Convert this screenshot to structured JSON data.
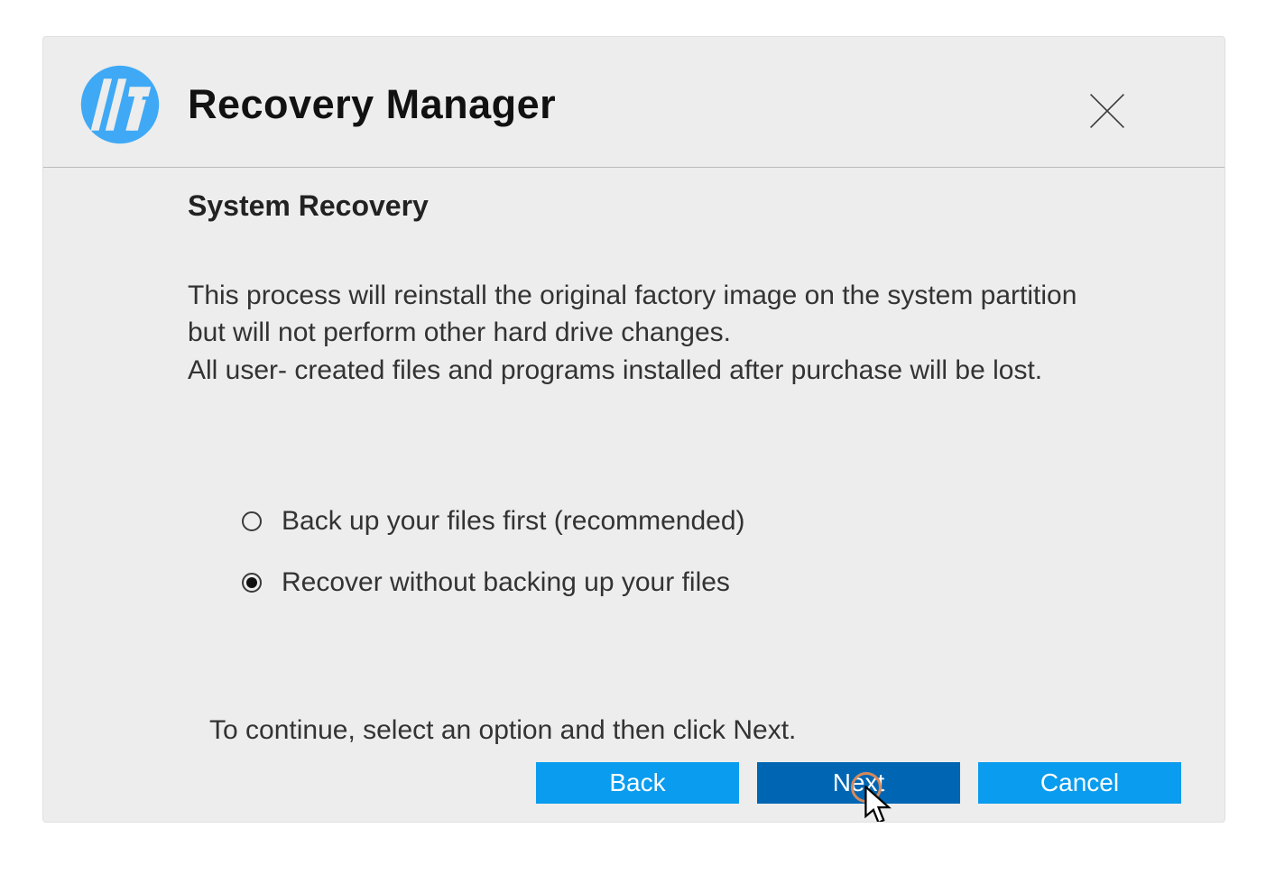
{
  "header": {
    "app_title": "Recovery Manager"
  },
  "page": {
    "title": "System Recovery",
    "description_line1": "This process will reinstall the original factory image on the system partition but will not perform other hard drive changes.",
    "description_line2": "All user- created files and programs installed after purchase will be lost.",
    "instruction": "To continue, select an option and then click Next."
  },
  "options": [
    {
      "label": "Back up your files first (recommended)",
      "selected": false
    },
    {
      "label": "Recover without backing up your files",
      "selected": true
    }
  ],
  "buttons": {
    "back": "Back",
    "next": "Next",
    "cancel": "Cancel"
  }
}
